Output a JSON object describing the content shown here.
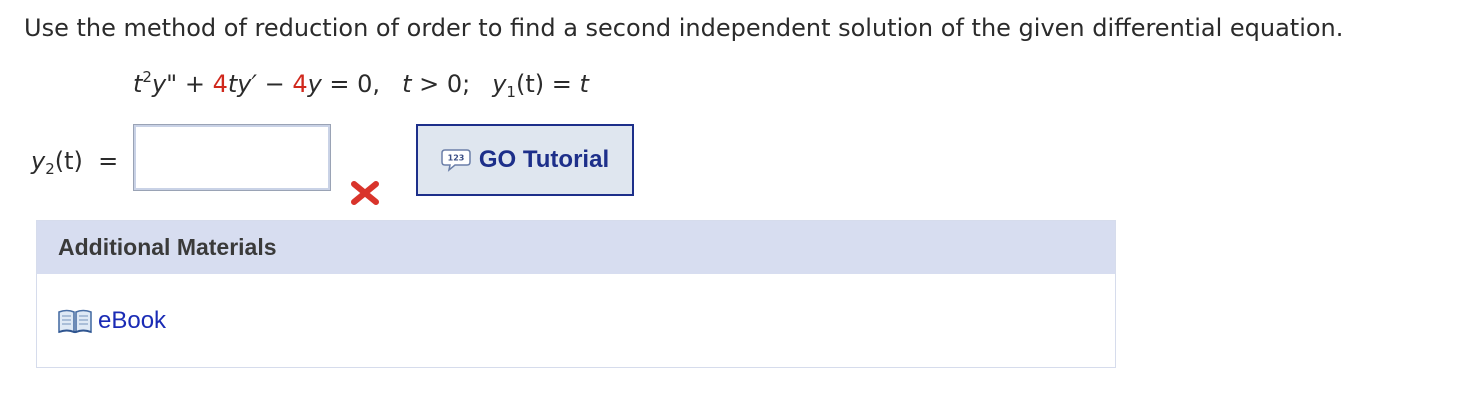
{
  "question": {
    "prompt": "Use the method of reduction of order to find a second independent solution of the given differential equation."
  },
  "equation": {
    "t": "t",
    "exp2": "2",
    "y_dd": "y\"",
    "plus": " + ",
    "coef1": "4",
    "ty_d": "ty′",
    "minus": " − ",
    "coef2": "4",
    "y": "y",
    "eq_zero": " = 0,",
    "cond_t": "t",
    "cond_rest": " > 0;",
    "y1_y": "y",
    "y1_sub": "1",
    "y1_paren": "(t)",
    "y1_eq": " = ",
    "y1_val": "t"
  },
  "answer": {
    "label_y": "y",
    "label_sub": "2",
    "label_rest": "(t)",
    "label_eq": "=",
    "value": "",
    "placeholder": "",
    "status_icon": "red-x-icon",
    "status_color": "#d9342b"
  },
  "tutorial": {
    "label": "GO Tutorial",
    "icon": "speech-bubble-123-icon"
  },
  "materials": {
    "title": "Additional Materials",
    "ebook_label": "eBook",
    "ebook_icon": "open-book-icon"
  },
  "colors": {
    "accent_red": "#d0281c",
    "tutorial_border": "#1d2f8a",
    "tutorial_bg": "#dfe6ef",
    "materials_header_bg": "#d7ddf0",
    "link_blue": "#1a2bb5"
  }
}
